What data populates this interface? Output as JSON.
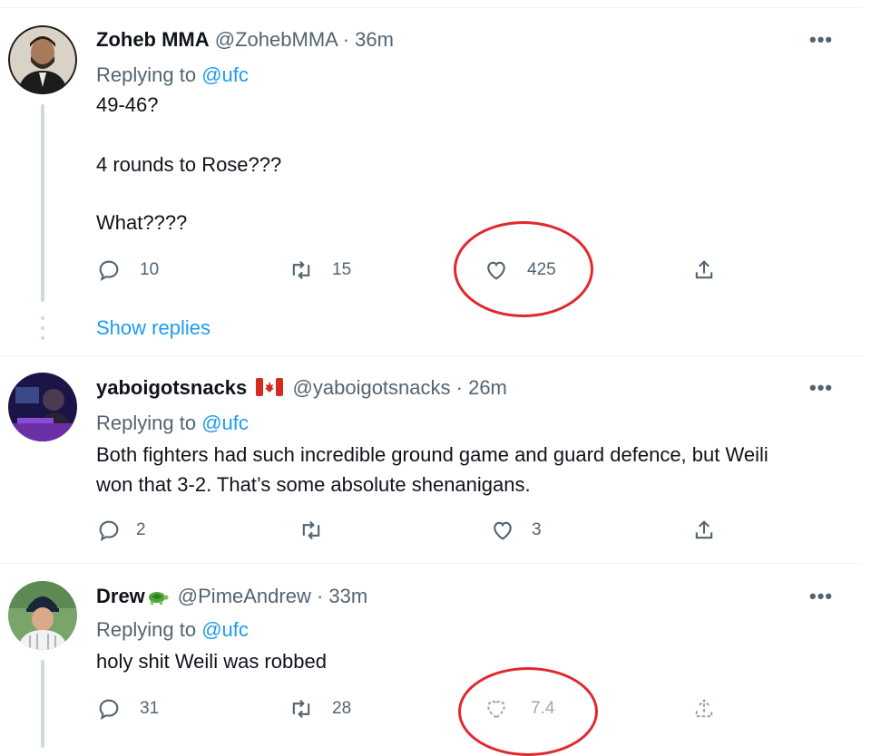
{
  "tweets": [
    {
      "name": "Zoheb MMA",
      "flag_icon": "",
      "handle": "@ZohebMMA",
      "time": "· 36m",
      "replying_prefix": "Replying to",
      "replying_to": "@ufc",
      "body_lines": [
        "49-46?",
        "4 rounds to Rose???",
        "What????"
      ],
      "replies": "10",
      "retweets": "15",
      "likes": "425",
      "show_replies": "Show replies"
    },
    {
      "name": "yaboigotsnacks",
      "flag_icon": "canada-flag-icon",
      "handle": "@yaboigotsnacks",
      "time": "· 26m",
      "replying_prefix": "Replying to",
      "replying_to": "@ufc",
      "body_lines": [
        "Both fighters had such incredible ground game and guard defence, but Weili",
        "won that 3-2. That’s some absolute shenanigans."
      ],
      "replies": "2",
      "retweets": "",
      "likes": "3"
    },
    {
      "name": "Drew",
      "emoji_icon": "turtle-icon",
      "handle": "@PimeAndrew",
      "time": "· 33m",
      "replying_prefix": "Replying to",
      "replying_to": "@ufc",
      "body_lines": [
        "holy shit Weili was robbed"
      ],
      "replies": "31",
      "retweets": "28",
      "likes": "7.4",
      "likes_note": "partially obscured"
    }
  ],
  "more_label": "•••",
  "colors": {
    "accent": "#1d9bf0",
    "muted": "#536471",
    "annotation": "#e0282d"
  }
}
